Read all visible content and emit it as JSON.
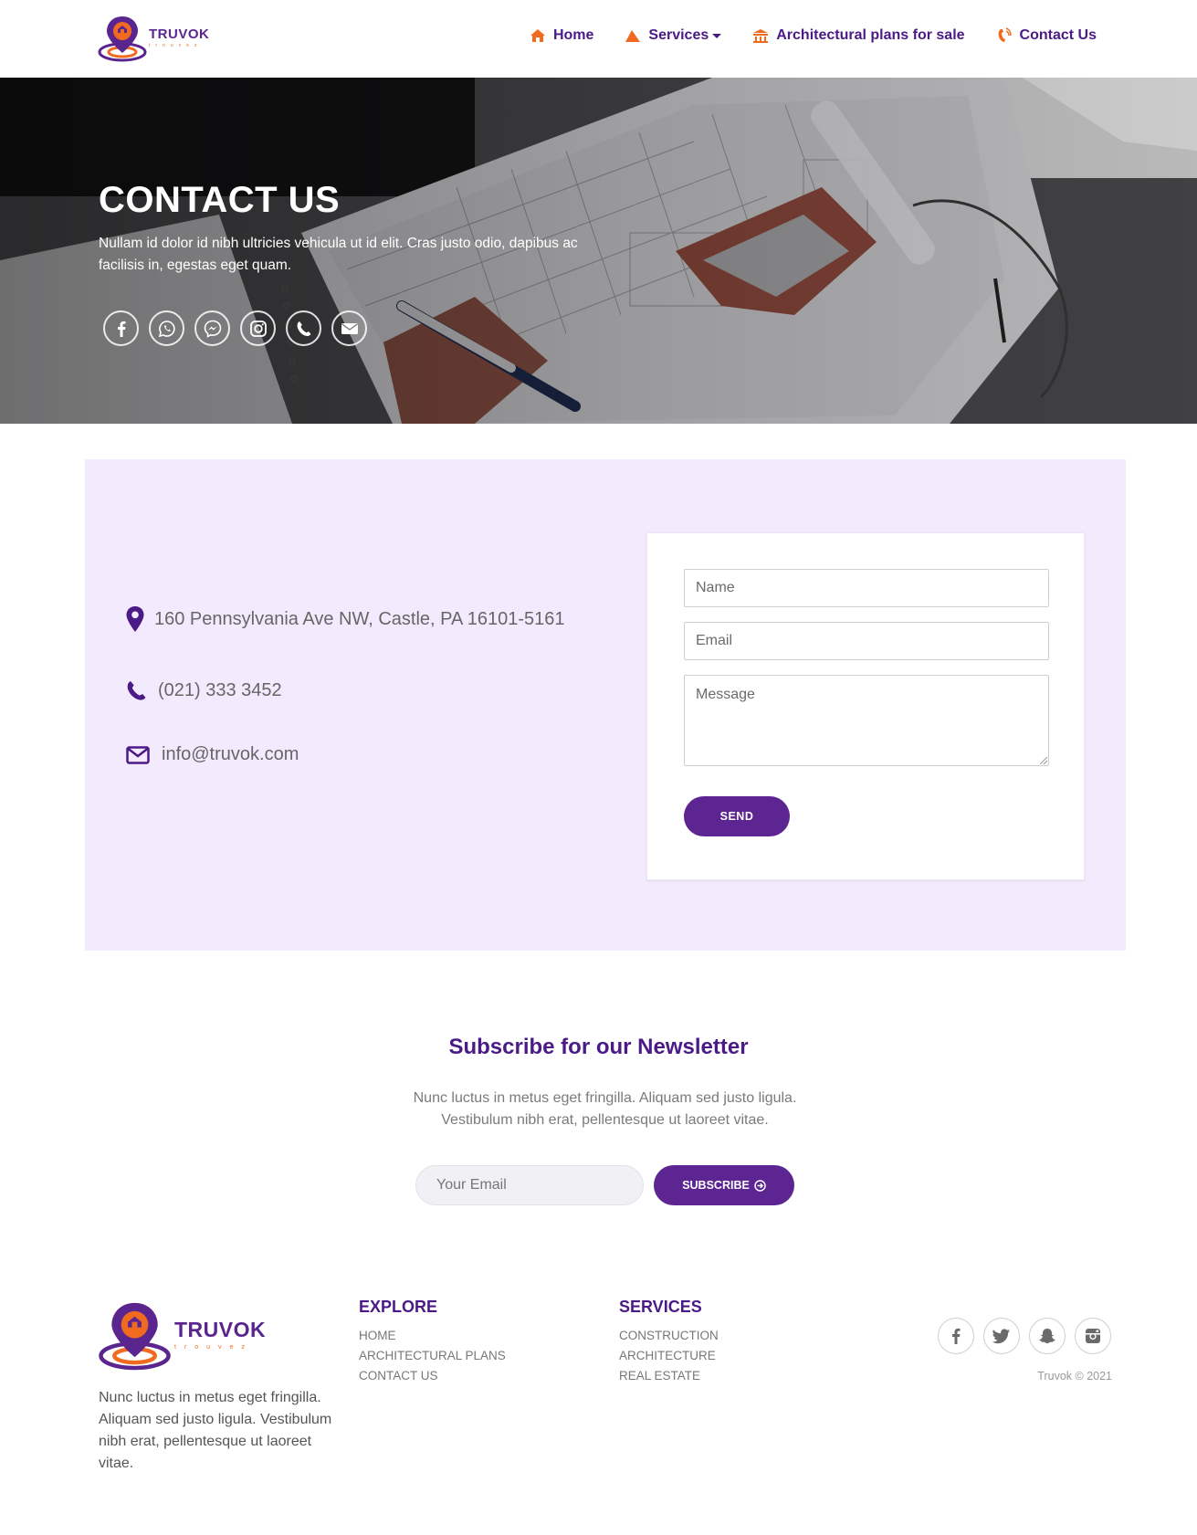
{
  "brand": {
    "name": "TRUVOK",
    "tagline": "trouvez"
  },
  "colors": {
    "primary": "#5c2592",
    "heading": "#4a1a86",
    "accent": "#f06b1f",
    "contact_bg": "#f4eafd"
  },
  "nav": {
    "items": [
      {
        "label": "Home",
        "icon": "home-icon"
      },
      {
        "label": "Services",
        "icon": "megaphone-icon",
        "dropdown": true
      },
      {
        "label": "Architectural plans for sale",
        "icon": "building-icon"
      },
      {
        "label": "Contact Us",
        "icon": "phone-ring-icon"
      }
    ]
  },
  "hero": {
    "title": "CONTACT US",
    "subtitle": "Nullam id dolor id nibh ultricies vehicula ut id elit. Cras justo odio, dapibus ac facilisis in, egestas eget quam.",
    "socials": [
      "facebook-icon",
      "whatsapp-icon",
      "messenger-icon",
      "instagram-icon",
      "phone-icon",
      "email-icon"
    ]
  },
  "contact": {
    "address": "160 Pennsylvania Ave NW, Castle, PA 16101-5161",
    "phone": "(021) 333 3452",
    "email": "info@truvok.com",
    "form": {
      "name_placeholder": "Name",
      "email_placeholder": "Email",
      "message_placeholder": "Message",
      "send_label": "SEND"
    }
  },
  "newsletter": {
    "title": "Subscribe for our Newsletter",
    "text": "Nunc luctus in metus eget fringilla. Aliquam sed justo ligula. Vestibulum nibh erat, pellentesque ut laoreet vitae.",
    "email_placeholder": "Your Email",
    "button_label": "SUBSCRIBE"
  },
  "footer": {
    "about": "Nunc luctus in metus eget fringilla. Aliquam sed justo ligula. Vestibulum nibh erat, pellentesque ut laoreet vitae.",
    "explore": {
      "title": "EXPLORE",
      "links": [
        "HOME",
        "ARCHITECTURAL PLANS",
        "CONTACT US"
      ]
    },
    "services": {
      "title": "SERVICES",
      "links": [
        "CONSTRUCTION",
        "ARCHITECTURE",
        "REAL ESTATE"
      ]
    },
    "socials": [
      "facebook-icon",
      "twitter-icon",
      "snapchat-icon",
      "instagram-icon"
    ],
    "copyright": "Truvok © 2021"
  }
}
